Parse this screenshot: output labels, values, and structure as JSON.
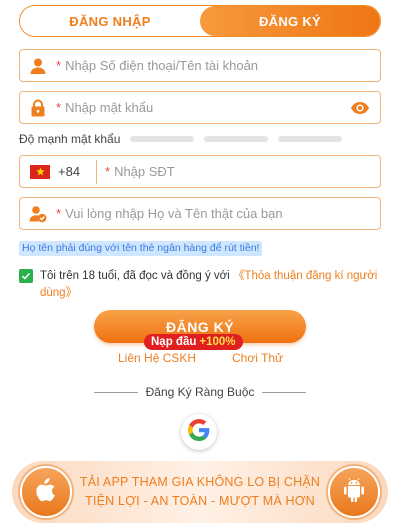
{
  "tabs": {
    "login": "ĐĂNG NHẬP",
    "register": "ĐĂNG KÝ"
  },
  "fields": {
    "account": {
      "required": "*",
      "placeholder": "Nhập Số điện thoại/Tên tài khoản"
    },
    "password": {
      "required": "*",
      "placeholder": "Nhập mật khẩu"
    },
    "phone": {
      "code": "+84",
      "required": "*",
      "placeholder": "Nhập SĐT"
    },
    "fullname": {
      "required": "*",
      "placeholder": "Vui lòng nhập Họ và Tên thật của bạn"
    }
  },
  "strength": {
    "label": "Độ mạnh mật khẩu"
  },
  "hint": "Họ tên phải đúng với tên thẻ ngân hàng để rút tiền!",
  "agreement": {
    "text": "Tôi trên 18 tuổi, đã đọc và đồng ý với ",
    "link": "《Thỏa thuận đăng kí người dùng》"
  },
  "register_button": "ĐĂNG KÝ",
  "promo": {
    "label": "Nạp đầu",
    "percent": "+100%"
  },
  "links": {
    "support": "Liên Hệ CSKH",
    "trial": "Chơi Thử"
  },
  "divider": "Đăng Ký Ràng Buộc",
  "banner": {
    "line1": "TẢI APP THAM GIA KHÔNG LO BỊ CHẶN",
    "line2": "TIỆN LỢI - AN TOÀN - MƯỢT MÀ HƠN"
  },
  "icons": {
    "account": "user-icon",
    "password": "lock-icon",
    "show_password": "eye-icon",
    "country": "vietnam-flag-icon",
    "fullname": "user-check-icon",
    "checkbox": "check-icon",
    "google": "google-icon",
    "ios": "apple-icon",
    "android": "android-icon"
  },
  "colors": {
    "accent": "#ef7e1e",
    "hint": "#3a7be0",
    "checkbox": "#2bb04a",
    "promo": "#e02020"
  }
}
